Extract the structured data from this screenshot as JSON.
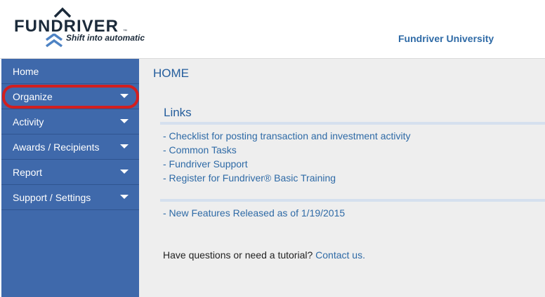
{
  "header": {
    "logo_text": "FUNDRIVER",
    "logo_tm": "™",
    "logo_tagline": "Shift into automatic",
    "org_name": "Fundriver University"
  },
  "sidebar": {
    "items": [
      {
        "label": "Home",
        "has_dropdown": false
      },
      {
        "label": "Organize",
        "has_dropdown": true,
        "highlighted": true
      },
      {
        "label": "Activity",
        "has_dropdown": true
      },
      {
        "label": "Awards / Recipients",
        "has_dropdown": true
      },
      {
        "label": "Report",
        "has_dropdown": true
      },
      {
        "label": "Support / Settings",
        "has_dropdown": true
      }
    ]
  },
  "main": {
    "title": "HOME",
    "links_heading": "Links",
    "links": [
      "- Checklist for posting transaction and investment activity",
      "- Common Tasks",
      "- Fundriver Support",
      "- Register for Fundriver® Basic Training"
    ],
    "news_link": "- New Features Released as of 1/19/2015",
    "help_text": "Have questions or need a tutorial?",
    "help_link": "Contact us."
  },
  "colors": {
    "sidebar_bg": "#3f69ab",
    "link": "#2e6aa6",
    "heading": "#245d9c",
    "highlight_ring": "#d21f1f",
    "content_bg": "#eeeeee"
  },
  "icons": [
    "logo-chevron-icon",
    "caret-down-icon"
  ]
}
